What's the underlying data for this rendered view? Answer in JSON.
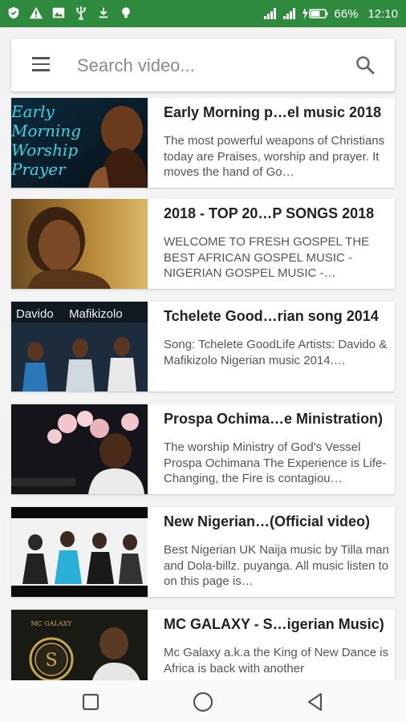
{
  "status_bar": {
    "left_icons": [
      "shield-icon",
      "warning-icon",
      "image-icon",
      "usb-icon",
      "download-icon",
      "lightbulb-icon"
    ],
    "battery": "66%",
    "time": "12:10"
  },
  "search": {
    "placeholder": "Search video...",
    "value": ""
  },
  "videos": [
    {
      "title": "Early Morning p…el music 2018",
      "description": "The most powerful weapons of Christians today are Praises, worship and prayer. It moves the hand of Go…",
      "thumb_text": [
        "Early",
        "Morning",
        "Worship",
        "Prayer"
      ]
    },
    {
      "title": "2018 - TOP 20…P SONGS 2018",
      "description": "WELCOME TO FRESH GOSPEL THE BEST AFRICAN GOSPEL MUSIC - NIGERIAN GOSPEL MUSIC -…"
    },
    {
      "title": "Tchelete Good…rian song 2014",
      "description": "Song: Tchelete GoodLife Artists: Davido & Mafikizolo Nigerian music 2014.…",
      "thumb_text": [
        "Davido",
        "Mafikizolo"
      ]
    },
    {
      "title": "Prospa Ochima…e Ministration)",
      "description": "The worship Ministry of God's Vessel Prospa Ochimana The Experience is Life-Changing, the Fire is contagiou…"
    },
    {
      "title": "New Nigerian…(Official video)",
      "description": "Best Nigerian UK Naija music by Tilla man and Dola-billz. puyanga. All music listen to on this page is…"
    },
    {
      "title": "MC GALAXY - S…igerian Music)",
      "description": "Mc Galaxy a.k.a the King of New Dance is Africa is back with another",
      "thumb_text": [
        "MC GALAXY",
        "S"
      ]
    }
  ],
  "colors": {
    "status_bar": "#2e8b3e",
    "background": "#f3f3f3",
    "accent_cyan": "#38d6e8"
  }
}
